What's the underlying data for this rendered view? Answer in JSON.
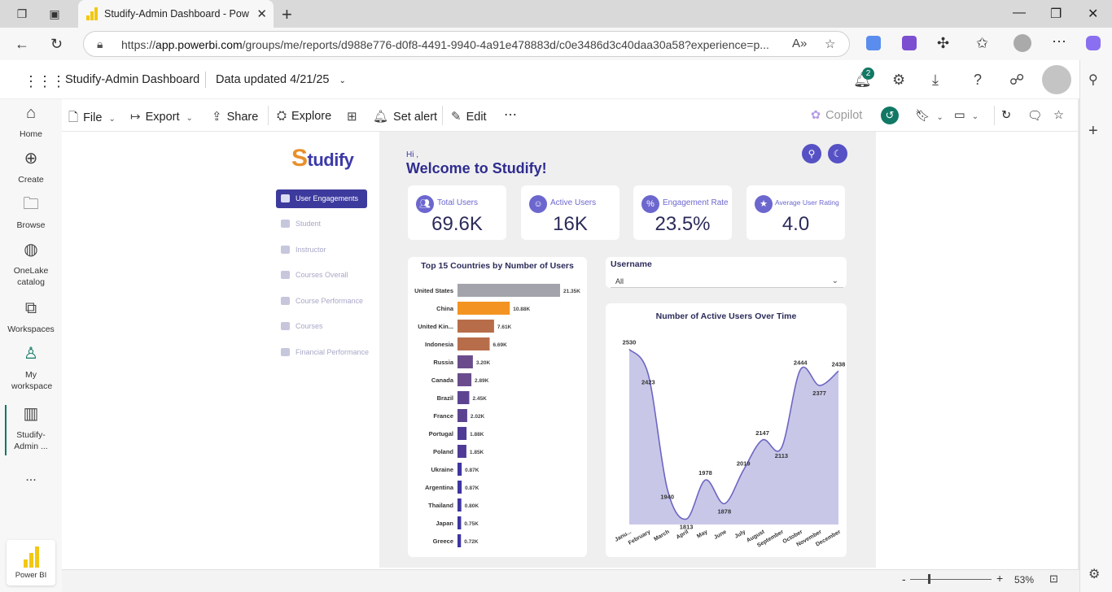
{
  "browser": {
    "tab_title": "Studify-Admin Dashboard - Powe",
    "url_prefix": "https://",
    "url_domain": "app.powerbi.com",
    "url_rest": "/groups/me/reports/d988e776-d0f8-4491-9940-4a91e478883d/c0e3486d3c40daa30a58?experience=p..."
  },
  "header": {
    "report_name": "Studify-Admin Dashboard",
    "data_updated": "Data updated 4/21/25",
    "notification_count": "2"
  },
  "rail": {
    "items": [
      {
        "label": "Home",
        "icon": "home-icon"
      },
      {
        "label": "Create",
        "icon": "plus-circle-icon"
      },
      {
        "label": "Browse",
        "icon": "folder-icon"
      },
      {
        "label": "OneLake catalog",
        "icon": "onelake-icon"
      },
      {
        "label": "Workspaces",
        "icon": "workspaces-icon"
      },
      {
        "label": "My workspace",
        "icon": "person-icon"
      },
      {
        "label": "Studify-Admin ...",
        "icon": "report-icon"
      }
    ],
    "more": "...",
    "product": "Power BI"
  },
  "ribbon": {
    "file": "File",
    "export": "Export",
    "share": "Share",
    "explore": "Explore",
    "set_alert": "Set alert",
    "edit": "Edit",
    "more": "⋯",
    "copilot": "Copilot"
  },
  "report": {
    "brand": {
      "first": "S",
      "rest": "tudify"
    },
    "nav": [
      {
        "label": "User Engagements",
        "active": true
      },
      {
        "label": "Student",
        "active": false
      },
      {
        "label": "Instructor",
        "active": false
      },
      {
        "label": "Courses Overall",
        "active": false
      },
      {
        "label": "Course Performance",
        "active": false
      },
      {
        "label": "Courses",
        "active": false
      },
      {
        "label": "Financial Performance",
        "active": false
      }
    ],
    "greeting": "Hi ,",
    "welcome": "Welcome to Studify!",
    "kpis": [
      {
        "label": "Total Users",
        "value": "69.6K"
      },
      {
        "label": "Active Users",
        "value": "16K"
      },
      {
        "label": "Engagement Rate",
        "value": "23.5%"
      },
      {
        "label": "Average User Rating",
        "value": "4.0"
      }
    ],
    "slicer": {
      "label": "Username",
      "value": "All"
    }
  },
  "chart_data": [
    {
      "type": "bar",
      "orientation": "horizontal",
      "title": "Top 15 Countries by Number of Users",
      "categories": [
        "United States",
        "China",
        "United Kin...",
        "Indonesia",
        "Russia",
        "Canada",
        "Brazil",
        "France",
        "Portugal",
        "Poland",
        "Ukraine",
        "Argentina",
        "Thailand",
        "Japan",
        "Greece"
      ],
      "values": [
        21350,
        10880,
        7610,
        6690,
        3200,
        2890,
        2450,
        2020,
        1880,
        1850,
        870,
        870,
        800,
        750,
        720
      ],
      "data_labels": [
        "21.35K",
        "10.88K",
        "7.61K",
        "6.69K",
        "3.20K",
        "2.89K",
        "2.45K",
        "2.02K",
        "1.88K",
        "1.85K",
        "0.87K",
        "0.87K",
        "0.80K",
        "0.75K",
        "0.72K"
      ],
      "colors": [
        "#a3a3ac",
        "#f39422",
        "#b86d4a",
        "#b86d4a",
        "#6a4c8c",
        "#6a4c8c",
        "#5c4392",
        "#5c4392",
        "#4f3b96",
        "#4f3b96",
        "#3f35a0",
        "#3f35a0",
        "#3f35a0",
        "#3f35a0",
        "#3f35a0"
      ]
    },
    {
      "type": "area",
      "title": "Number of Active Users Over Time",
      "categories": [
        "Janu...",
        "February",
        "March",
        "April",
        "May",
        "June",
        "July",
        "August",
        "September",
        "October",
        "November",
        "December"
      ],
      "values": [
        2530,
        2423,
        1940,
        1813,
        1978,
        1878,
        2019,
        2147,
        2113,
        2444,
        2377,
        2438
      ],
      "ylim": [
        1790,
        2590
      ],
      "fill": "#c9c7e8",
      "line": "#6d66c2"
    }
  ]
}
